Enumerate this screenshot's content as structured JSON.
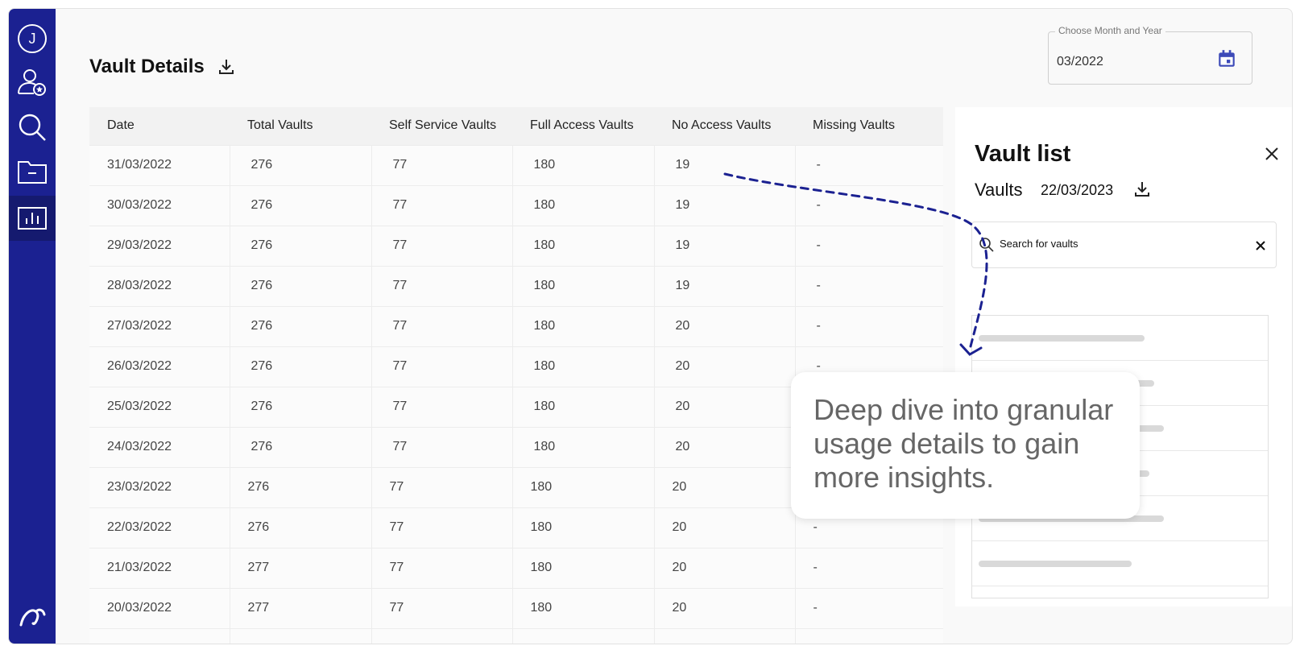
{
  "user": {
    "initial": "J"
  },
  "sidebar": {
    "items": [
      {
        "icon": "user-admin-icon"
      },
      {
        "icon": "search-icon"
      },
      {
        "icon": "folder-icon"
      },
      {
        "icon": "chart-icon",
        "active": true
      }
    ],
    "brand_icon": "brand-logo-icon"
  },
  "page": {
    "title": "Vault Details"
  },
  "date_picker": {
    "label": "Choose Month and Year",
    "value": "03/2022"
  },
  "table": {
    "columns": [
      "Date",
      "Total Vaults",
      "Self Service Vaults",
      "Full Access Vaults",
      "No Access Vaults",
      "Missing Vaults"
    ],
    "rows": [
      [
        "31/03/2022",
        "276",
        "77",
        "180",
        "19",
        "-"
      ],
      [
        "30/03/2022",
        "276",
        "77",
        "180",
        "19",
        "-"
      ],
      [
        "29/03/2022",
        "276",
        "77",
        "180",
        "19",
        "-"
      ],
      [
        "28/03/2022",
        "276",
        "77",
        "180",
        "19",
        "-"
      ],
      [
        "27/03/2022",
        "276",
        "77",
        "180",
        "20",
        "-"
      ],
      [
        "26/03/2022",
        "276",
        "77",
        "180",
        "20",
        "-"
      ],
      [
        "25/03/2022",
        "276",
        "77",
        "180",
        "20",
        ""
      ],
      [
        "24/03/2022",
        "276",
        "77",
        "180",
        "20",
        ""
      ],
      [
        "23/03/2022",
        "276",
        "77",
        "180",
        "20",
        ""
      ],
      [
        "22/03/2022",
        "276",
        "77",
        "180",
        "20",
        "-"
      ],
      [
        "21/03/2022",
        "277",
        "77",
        "180",
        "20",
        "-"
      ],
      [
        "20/03/2022",
        "277",
        "77",
        "180",
        "20",
        "-"
      ]
    ]
  },
  "panel": {
    "title": "Vault list",
    "vaults_label": "Vaults",
    "vaults_date": "22/03/2023",
    "search_placeholder": "Search for vaults"
  },
  "callout": {
    "text": "Deep dive into granular usage details to gain more insights."
  },
  "colors": {
    "sidebar": "#1b2191",
    "accent": "#3d4ab8",
    "arrow": "#1b2191"
  }
}
